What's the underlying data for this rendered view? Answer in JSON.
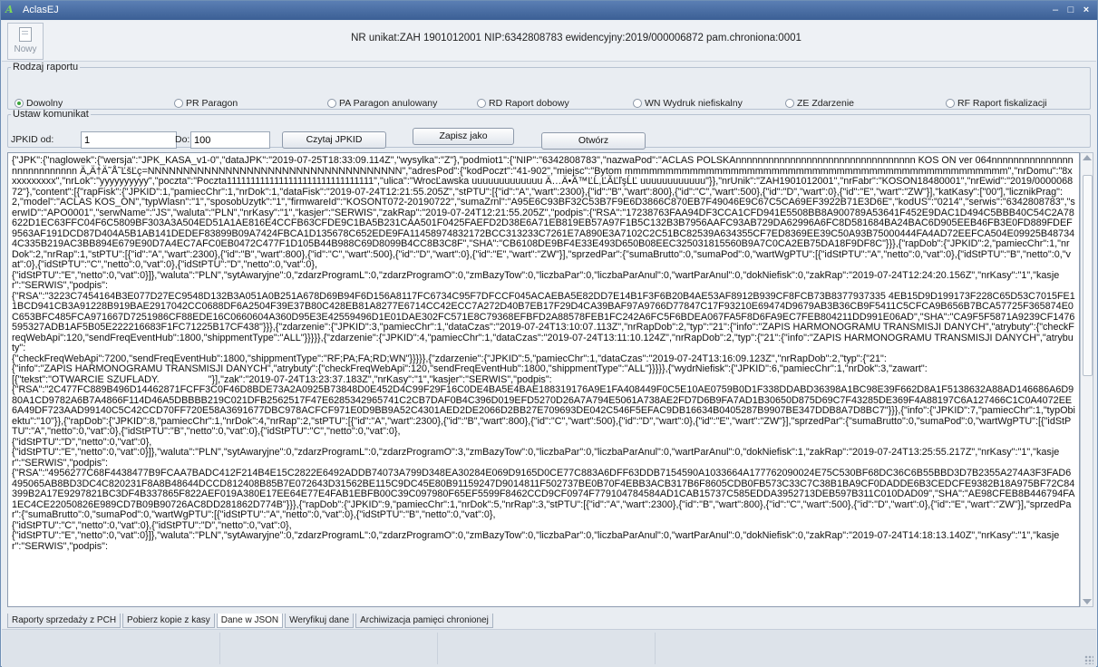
{
  "window": {
    "title": "AclasEJ",
    "app_icon_glyph": "A",
    "minimize": "–",
    "maximize": "□",
    "close": "×"
  },
  "toolbar": {
    "new_label": "Nowy"
  },
  "header_info": "NR unikat:ZAH 1901012001   NIP:6342808783   ewidencyjny:2019/000006872   pam.chroniona:0001",
  "report_type": {
    "legend": "Rodzaj raportu",
    "options": [
      "Dowolny",
      "PR Paragon",
      "PA Paragon anulowany",
      "RD Raport dobowy",
      "WN Wydruk niefiskalny",
      "ZE Zdarzenie",
      "RF Raport fiskalizacji"
    ],
    "selected": "Dowolny"
  },
  "message": {
    "legend": "Ustaw komunikat",
    "jpkid_from_label": "JPKID od:",
    "jpkid_from_value": "1",
    "to_label": "Do:",
    "to_value": "100",
    "read_button": "Czytaj JPKID",
    "save_button": "Zapisz jako",
    "open_button": "Otwórz"
  },
  "json_text": "{\"JPK\":{\"naglowek\":{\"wersja\":\"JPK_KASA_v1-0\",\"dataJPK\":\"2019-07-25T18:33:09.114Z\",\"wysylka\":\"Z\"},\"podmiot1\":{\"NIP\":\"6342808783\",\"nazwaPod\":\"ACLAS POLSKAnnnnnnnnnnnnnnnnnnnnnnnnnnnnnnnnn KOS ON ver 064nnnnnnnnnnnnnnnnnnnnnnnnnnn Ä„Ä†Ä˜Å˜ĽšĽç=NNNNNNNNNNNNNNNNNNNNNNNNNNNNNNNNNNNN\",\"adresPod\":{\"kodPoczt\":\"41-902\",\"miejsc\":\"Bytom mmmmmmmmmmmmmmmmmmmmmmmmmmmmmmmmmmmmmmmmmmmmmmm\",\"nrDomu\":\"8xxxxxxxxxx\",\"nrLok\":\"yyyyyyyyyy\",\"poczta\":\"Poczta1111111111111111111111111111111\",\"ulica\":\"WrocĽawska uuuuuuuuuuuuu Ä…Ä•Ä™ĽĹ,ĽĂĽľşĹĽ uuuuuuuuuuuu\"}},\"nrUnik\":\"ZAH1901012001\",\"nrFabr\":\"KOSON18480001\",\"nrEwid\":\"2019/000006872\"},\"content\":[{\"rapFisk\":{\"JPKID\":1,\"pamiecChr\":1,\"nrDok\":1,\"dataFisk\":\"2019-07-24T12:21:55.205Z\",\"stPTU\":[{\"id\":\"A\",\"wart\":2300},{\"id\":\"B\",\"wart\":800},{\"id\":\"C\",\"wart\":500},{\"id\":\"D\",\"wart\":0},{\"id\":\"E\",\"wart\":\"ZW\"}],\"katKasy\":[\"00\"],\"licznikPrag\":2,\"model\":\"ACLAS KOS_ON\",\"typWlasn\":\"1\",\"sposobUzytk\":\"1\",\"firmwareId\":\"KOSONT072-20190722\",\"sumaZrnl\":\"A95E6C93BF32C53B7F9E6D3866C870EB7F49046E9C67C5CA69EF3922B71E3D6E\",\"kodUS\":\"0214\",\"serwis\":\"6342808783\",\"serwID\":\"APO0001\",\"serwName\":\"JS\",\"waluta\":\"PLN\",\"nrKasy\":\"1\",\"kasjer\":\"SERWIS\",\"zakRap\":\"2019-07-24T12:21:55.205Z\",\"podpis\":{\"RSA\":\"17238763FAA94DF3CCA1CFD941E5508BB8A900789A53641F452E9DAC1D494C5BBB40C54C2A78622D1EC63FFC04F6C5809BF303A3A504ED51A1AE816E4CCFB63CFDE9C1BA5B231CAA501F0425FAEFD2D38E6A71EB819EB57A97F1B5C132B3B7956AAFC93AB729DA62996A6FC8D581684BA24BAC6D905EEB46FB3E0FD889FDEF9563AF191DCD87D404A5B1AB141DEDEF83899B09A7424FBCA1D135678C652EDE9FA11458974832172BCC313233C7261E7A890E3A7102C2C51BC82539A634355CF7ED8369EE39C50A93B75000444FA4AD72EEFCA504E09925B487344C335B219AC3BB894E679E90D7A4EC7AFC0EB0472C477F1D105B44B988C69D8099B4CC8B3C8F\",\"SHA\":\"CB6108DE9BF4E33E493D650B08EEC325031815560B9A7C0CA2EB75DA18F9DF8C\"}}},{\"rapDob\":{\"JPKID\":2,\"pamiecChr\":1,\"nrDok\":2,\"nrRap\":1,\"stPTU\":[{\"id\":\"A\",\"wart\":2300},{\"id\":\"B\",\"wart\":800},{\"id\":\"C\",\"wart\":500},{\"id\":\"D\",\"wart\":0},{\"id\":\"E\",\"wart\":\"ZW\"}],\"sprzedPar\":{\"sumaBrutto\":0,\"sumaPod\":0,\"wartWgPTU\":[{\"idStPTU\":\"A\",\"netto\":0,\"vat\":0},{\"idStPTU\":\"B\",\"netto\":0,\"vat\":0},{\"idStPTU\":\"C\",\"netto\":0,\"vat\":0},{\"idStPTU\":\"D\",\"netto\":0,\"vat\":0},\n{\"idStPTU\":\"E\",\"netto\":0,\"vat\":0}]},\"waluta\":\"PLN\",\"sytAwaryjne\":0,\"zdarzProgramL\":0,\"zdarzProgramO\":0,\"zmBazyTow\":0,\"liczbaPar\":0,\"liczbaParAnul\":0,\"wartParAnul\":0,\"dokNiefisk\":0,\"zakRap\":\"2019-07-24T12:24:20.156Z\",\"nrKasy\":\"1\",\"kasjer\":\"SERWIS\",\"podpis\":\n{\"RSA\":\"3223C7454164B3E077D27EC9548D132B3A051A0B251A678D69B94F6D156A8117FC6734C95F7DFCCF045ACAEBA5E82DD7E14B1F3F6B20B4AE53AF8912B939CF8FCB73B8377937335 4EB15D9D199173F228C65D53C7015FE11BCD941CB3A91228B919BAE2917042CC0688DF6A2504F39E37B80C428EB81A8277E6714CC42ECC7A272D40B7EB17F29D4CA39BAF97A9766D77847C17F93210E69474D9679AB3B36CB9F5411C5CFCA9B656B7BCA57725F365874E0C653BFC485FCA971667D7251986CF88EDE16C0660604A360D95E3E42559496D1E01DAE302FC571E8C79368EFBFD2A88578FEB1FC242A6FC5F6BDEA067FA5F8D6FA9EC7FEB804211DD991E06AD\",\"SHA\":\"CA9F5F5871A9239CF1476595327ADB1AF5B05E222216683F1FC71225B17CF438\"}}},{\"zdarzenie\":{\"JPKID\":3,\"pamiecChr\":1,\"dataCzas\":\"2019-07-24T13:10:07.113Z\",\"nrRapDob\":2,\"typ\":\"21\":{\"info\":\"ZAPIS HARMONOGRAMU TRANSMISJI DANYCH\",\"atrybuty\":{\"checkFreqWebApi\":120,\"sendFreqEventHub\":1800,\"shippmentType\":\"ALL\"}}}}},{\"zdarzenie\":{\"JPKID\":4,\"pamiecChr\":1,\"dataCzas\":\"2019-07-24T13:11:10.124Z\",\"nrRapDob\":2,\"typ\":{\"21\":{\"info\":\"ZAPIS HARMONOGRAMU TRANSMISJI DANYCH\",\"atrybuty\":\n{\"checkFreqWebApi\":7200,\"sendFreqEventHub\":1800,\"shippmentType\":\"RF;PA;FA;RD;WN\"}}}}},{\"zdarzenie\":{\"JPKID\":5,\"pamiecChr\":1,\"dataCzas\":\"2019-07-24T13:16:09.123Z\",\"nrRapDob\":2,\"typ\":{\"21\":\n{\"info\":\"ZAPIS HARMONOGRAMU TRANSMISJI DANYCH\",\"atrybuty\":{\"checkFreqWebApi\":120,\"sendFreqEventHub\":1800,\"shippmentType\":\"ALL\"}}}}},{\"wydrNiefisk\":{\"JPKID\":6,\"pamiecChr\":1,\"nrDok\":3,\"zawart\":\n[{\"tekst\":\"OTWARCIE SZUFLADY.                  \"}],\"zak\":\"2019-07-24T13:23:37.183Z\",\"nrKasy\":\"1\",\"kasjer\":\"SERWIS\",\"podpis\":\n{\"RSA\":\"2C477FC889B496D14462871FCFF3C0F46D8BDE73A2A0925B73848D0E452D4C99F29F16C0DE4BA5E4BAE188319176A9E1FA408449F0C5E10AE0759B0D1F338DDABD36398A1BC98E39F662D8A1F5138632A88AD146686A6D980A1CD9782A6B7A4866F114D46A5DBBBB219C021DFB2562517F47E6285342965741C2CB7DAF0B4C396D019EFD5270D26A7A794E5061A738AE2FD7D6B9FA7AD1B30650D875D69C7F43285DE369F4A88197C6A127466C1C0A4072EE6A49DF723AAD99140C5C42CCD70FF720E58A3691677DBC978ACFCF971E0D9BB9A52C4301AED2DE2066D2BB27E709693DE042C546F5EFAC9DB16634B0405287B9907BE347DDB8A7D8BC7\"}}},{\"info\":{\"JPKID\":7,\"pamiecChr\":1,\"typObiektu\":\"10\"}},{\"rapDob\":{\"JPKID\":8,\"pamiecChr\":1,\"nrDok\":4,\"nrRap\":2,\"stPTU\":[{\"id\":\"A\",\"wart\":2300},{\"id\":\"B\",\"wart\":800},{\"id\":\"C\",\"wart\":500},{\"id\":\"D\",\"wart\":0},{\"id\":\"E\",\"wart\":\"ZW\"}],\"sprzedPar\":{\"sumaBrutto\":0,\"sumaPod\":0,\"wartWgPTU\":[{\"idStPTU\":\"A\",\"netto\":0,\"vat\":0},{\"idStPTU\":\"B\",\"netto\":0,\"vat\":0},{\"idStPTU\":\"C\",\"netto\":0,\"vat\":0},\n{\"idStPTU\":\"D\",\"netto\":0,\"vat\":0},\n{\"idStPTU\":\"E\",\"netto\":0,\"vat\":0}]},\"waluta\":\"PLN\",\"sytAwaryjne\":0,\"zdarzProgramL\":0,\"zdarzProgramO\":3,\"zmBazyTow\":0,\"liczbaPar\":0,\"liczbaParAnul\":0,\"wartParAnul\":0,\"dokNiefisk\":1,\"zakRap\":\"2019-07-24T13:25:55.217Z\",\"nrKasy\":\"1\",\"kasjer\":\"SERWIS\",\"podpis\":\n{\"RSA\":\"4956277C68F4438477B9FCAA7BADC412F214B4E15C2822E6492ADDB74073A799D348EA30284E069D9165D0CE77C883A6DFF63DDB7154590A1033664A177762090024E75C530BF68DC36C6B55BBD3D7B2355A274A3F3FAD6495065AB8BD3DC4C820231F8A8B48644DCCD812408B85B7E072643D31562BE115C9DC45E80B91159247D9014811F502737BE0B70F4EBB3ACB317B6F8605CDB0FB573C33C7C38B1BA9CF0DADDE6B3CEDCFE9382B18A975BF72C84399B2A17E9297821BC3DF4B337865F822AEF019A380E17EE64E77E4FAB1EBFB00C39C097980F65EF5599F8462CCD9CF0974F779104784584AD1CAB15737C585EDDA3952713DEB597B311C010DAD09\",\"SHA\":\"AE98CFEB8B446794FA1EC4CE22050826E989CD7B09B90726AC8DD281862D774B\"}}},{\"rapDob\":{\"JPKID\":9,\"pamiecChr\":1,\"nrDok\":5,\"nrRap\":3,\"stPTU\":[{\"id\":\"A\",\"wart\":2300},{\"id\":\"B\",\"wart\":800},{\"id\":\"C\",\"wart\":500},{\"id\":\"D\",\"wart\":0},{\"id\":\"E\",\"wart\":\"ZW\"}],\"sprzedPar\":{\"sumaBrutto\":0,\"sumaPod\":0,\"wartWgPTU\":[{\"idStPTU\":\"A\",\"netto\":0,\"vat\":0},{\"idStPTU\":\"B\",\"netto\":0,\"vat\":0},\n{\"idStPTU\":\"C\",\"netto\":0,\"vat\":0},{\"idStPTU\":\"D\",\"netto\":0,\"vat\":0},\n{\"idStPTU\":\"E\",\"netto\":0,\"vat\":0}]},\"waluta\":\"PLN\",\"sytAwaryjne\":0,\"zdarzProgramL\":0,\"zdarzProgramO\":0,\"zmBazyTow\":0,\"liczbaPar\":0,\"liczbaParAnul\":0,\"wartParAnul\":0,\"dokNiefisk\":0,\"zakRap\":\"2019-07-24T14:18:13.140Z\",\"nrKasy\":\"1\",\"kasjer\":\"SERWIS\",\"podpis\":",
  "tabs": [
    "Raporty sprzedaży z PCH",
    "Pobierz kopie z kasy",
    "Dane w JSON",
    "Weryfikuj dane",
    "Archiwizacja pamięci chronionej"
  ],
  "active_tab": "Dane w JSON",
  "colors": {
    "titlebar": "#3b5f95",
    "radio_selected": "#3aa63a",
    "window_bg": "#e9edf2"
  }
}
